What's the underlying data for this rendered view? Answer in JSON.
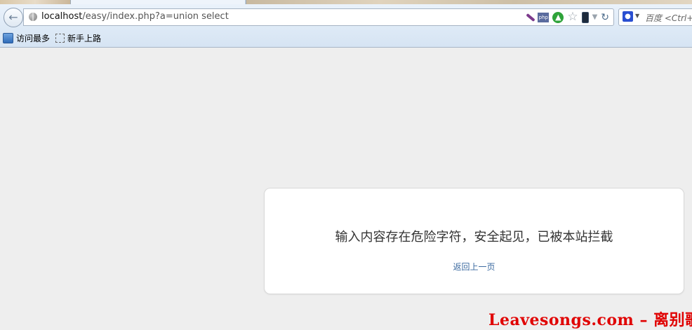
{
  "browser": {
    "url": {
      "host": "localhost",
      "path": "/easy/index.php?a=union select"
    },
    "url_icons": [
      "feather-icon",
      "php-icon",
      "green-arrow-icon",
      "star-icon",
      "phone-icon",
      "dropdown-icon",
      "reload-icon"
    ],
    "search": {
      "engine_icon": "baidu-paw-icon",
      "placeholder": "百度 <Ctrl+K>"
    },
    "bookmarks": [
      {
        "label": "访问最多",
        "icon": "most-visited-icon"
      },
      {
        "label": "新手上路",
        "icon": "dashed-folder-icon"
      }
    ]
  },
  "page": {
    "message": "输入内容存在危险字符，安全起见，已被本站拦截",
    "back_link": "返回上一页"
  },
  "watermark": {
    "text": "Leavesongs.com – 离别歌",
    "color": "#e00000"
  },
  "colors": {
    "background": "#eeeeee",
    "link": "#3b6aa0",
    "toolbar": "#dde9f6"
  }
}
